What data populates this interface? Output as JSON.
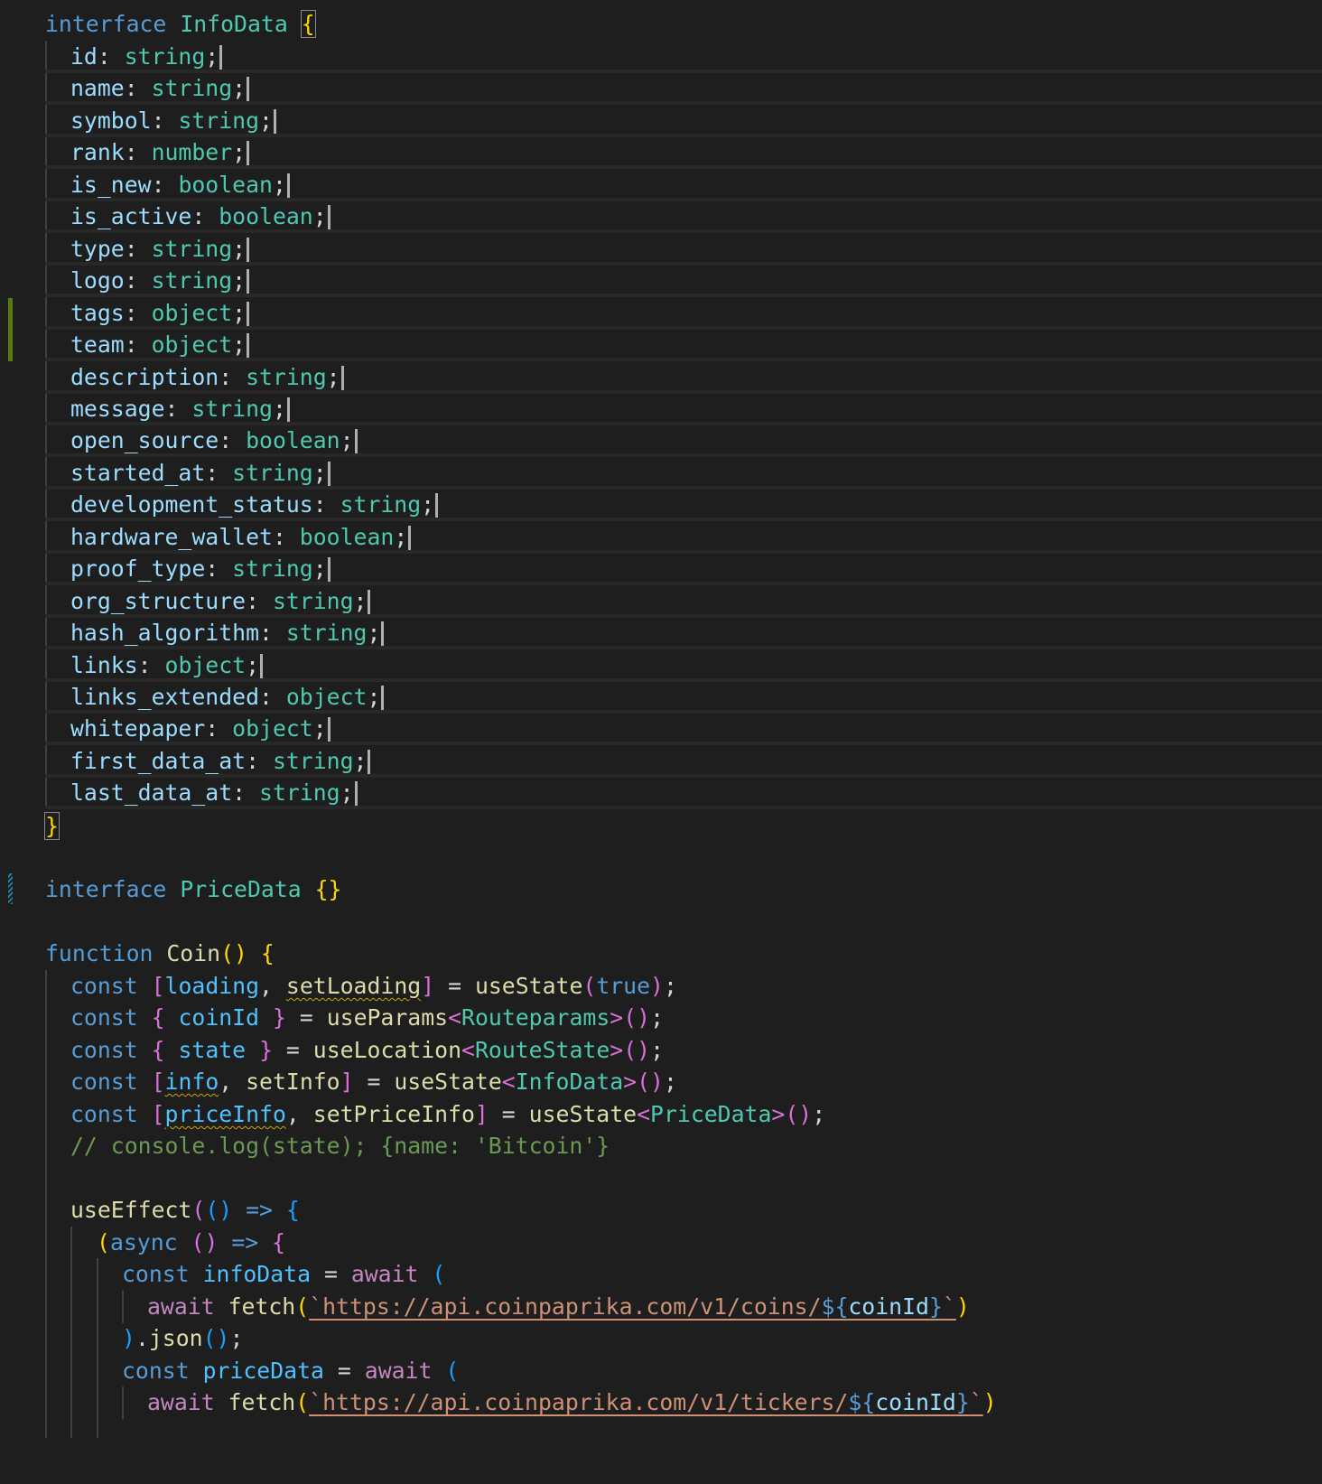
{
  "colors": {
    "background": "#1e1e1e",
    "keyword": "#569cd6",
    "control_keyword": "#c586c0",
    "type": "#4ec9b0",
    "property": "#9cdcfe",
    "function": "#dcdcaa",
    "string": "#ce9178",
    "comment": "#6a9955",
    "bracket_level1": "#ffd700",
    "bracket_level2": "#da70d6",
    "bracket_level3": "#179fff",
    "gutter_modified": "#587c0c",
    "gutter_added": "#1b81a8",
    "warning_squiggle": "#cca700"
  },
  "interface_info": {
    "keyword": "interface",
    "name": "InfoData",
    "open": "{",
    "close": "}",
    "fields": [
      {
        "name": "id",
        "type": "string"
      },
      {
        "name": "name",
        "type": "string"
      },
      {
        "name": "symbol",
        "type": "string"
      },
      {
        "name": "rank",
        "type": "number"
      },
      {
        "name": "is_new",
        "type": "boolean"
      },
      {
        "name": "is_active",
        "type": "boolean"
      },
      {
        "name": "type",
        "type": "string"
      },
      {
        "name": "logo",
        "type": "string"
      },
      {
        "name": "tags",
        "type": "object"
      },
      {
        "name": "team",
        "type": "object"
      },
      {
        "name": "description",
        "type": "string"
      },
      {
        "name": "message",
        "type": "string"
      },
      {
        "name": "open_source",
        "type": "boolean"
      },
      {
        "name": "started_at",
        "type": "string"
      },
      {
        "name": "development_status",
        "type": "string"
      },
      {
        "name": "hardware_wallet",
        "type": "boolean"
      },
      {
        "name": "proof_type",
        "type": "string"
      },
      {
        "name": "org_structure",
        "type": "string"
      },
      {
        "name": "hash_algorithm",
        "type": "string"
      },
      {
        "name": "links",
        "type": "object"
      },
      {
        "name": "links_extended",
        "type": "object"
      },
      {
        "name": "whitepaper",
        "type": "object"
      },
      {
        "name": "first_data_at",
        "type": "string"
      },
      {
        "name": "last_data_at",
        "type": "string"
      }
    ]
  },
  "interface_price": {
    "keyword": "interface",
    "name": "PriceData",
    "body": "{}"
  },
  "function_coin": {
    "keyword": "function",
    "name": "Coin",
    "parens": "()",
    "open": "{",
    "const_kw": "const",
    "loading": "loading",
    "setLoading": "setLoading",
    "useState": "useState",
    "true_kw": "true",
    "coinId": "coinId",
    "useParams": "useParams",
    "routeparams": "Routeparams",
    "state": "state",
    "useLocation": "useLocation",
    "routestate": "RouteState",
    "info": "info",
    "setInfo": "setInfo",
    "infodata": "InfoData",
    "priceInfo": "priceInfo",
    "setPriceInfo": "setPriceInfo",
    "pricedata": "PriceData",
    "comment": "// console.log(state); {name: 'Bitcoin'}",
    "useEffect": "useEffect",
    "arrow": "=>",
    "async_kw": "async",
    "await_kw": "await",
    "infoData_var": "infoData",
    "priceData_var": "priceData",
    "fetch": "fetch",
    "url_coins": "https://api.coinpaprika.com/v1/coins/",
    "url_tickers": "https://api.coinpaprika.com/v1/tickers/",
    "json": "json"
  }
}
